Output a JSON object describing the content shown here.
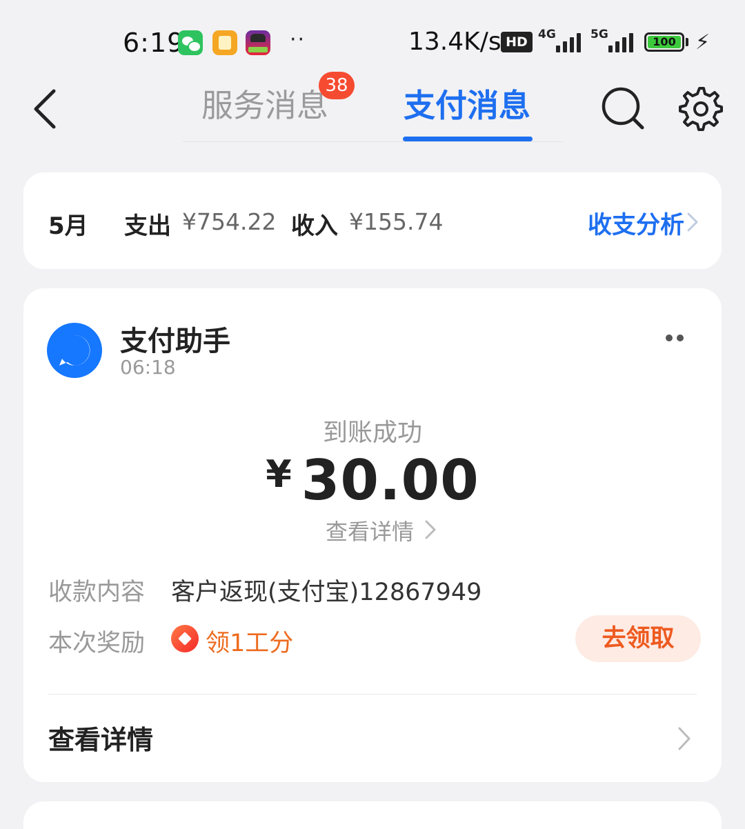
{
  "status_bar": {
    "time": "6:19",
    "dots": "··",
    "net_speed": "13.4K/s",
    "hd_label": "HD",
    "net_4g": "4G",
    "net_5g": "5G",
    "battery": "100",
    "bolt": "⚡",
    "app_icons": [
      "wechat-icon",
      "notes-icon",
      "game-icon"
    ]
  },
  "header": {
    "tabs": [
      {
        "label": "服务消息",
        "active": false,
        "badge": "38"
      },
      {
        "label": "支付消息",
        "active": true
      }
    ],
    "accent_color": "#1e6ff0",
    "badge_color": "#f54b31",
    "icons": [
      "back-icon",
      "search-icon",
      "settings-icon"
    ]
  },
  "summary": {
    "month": "5月",
    "expense_label": "支出",
    "expense_value": "¥754.22",
    "income_label": "收入",
    "income_value": "¥155.74",
    "analysis_link": "收支分析"
  },
  "message": {
    "sender": "支付助手",
    "time": "06:18",
    "status": "到账成功",
    "currency": "¥",
    "amount": "30.00",
    "detail_link": "查看详情",
    "content_label": "收款内容",
    "content_value": "客户返现(支付宝)12867949",
    "reward_label": "本次奖励",
    "reward_text": "领1工分",
    "claim_button": "去领取",
    "footer_detail": "查看详情"
  }
}
